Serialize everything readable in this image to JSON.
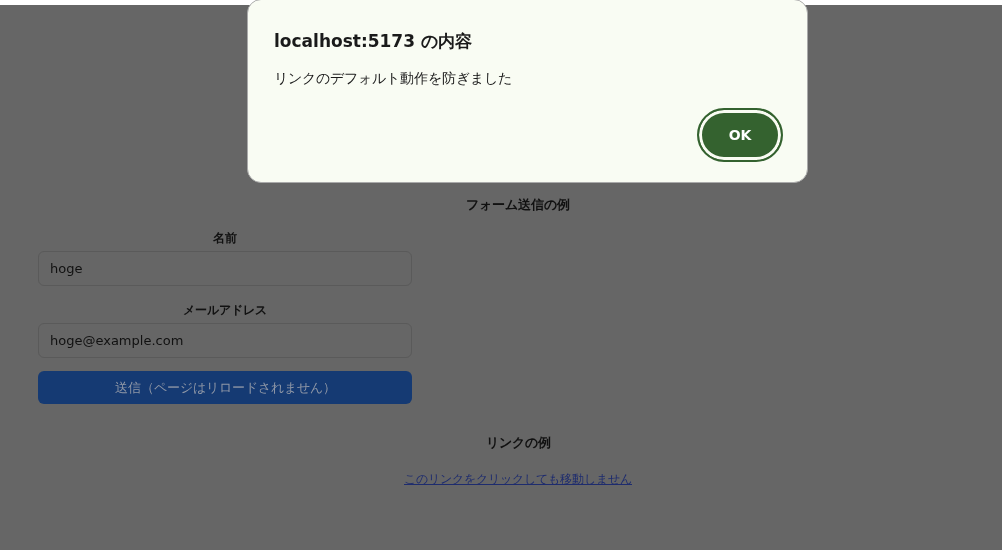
{
  "dialog": {
    "title": "localhost:5173 の内容",
    "message": "リンクのデフォルト動作を防ぎました",
    "buttons": [
      "OK"
    ]
  },
  "form_section": {
    "heading": "フォーム送信の例",
    "fields": [
      {
        "label": "名前",
        "value": "hoge"
      },
      {
        "label": "メールアドレス",
        "value": "hoge@example.com"
      }
    ],
    "submit": "送信（ページはリロードされません）"
  },
  "link_section": {
    "heading": "リンクの例",
    "link": "このリンクをクリックしても移動しません"
  }
}
